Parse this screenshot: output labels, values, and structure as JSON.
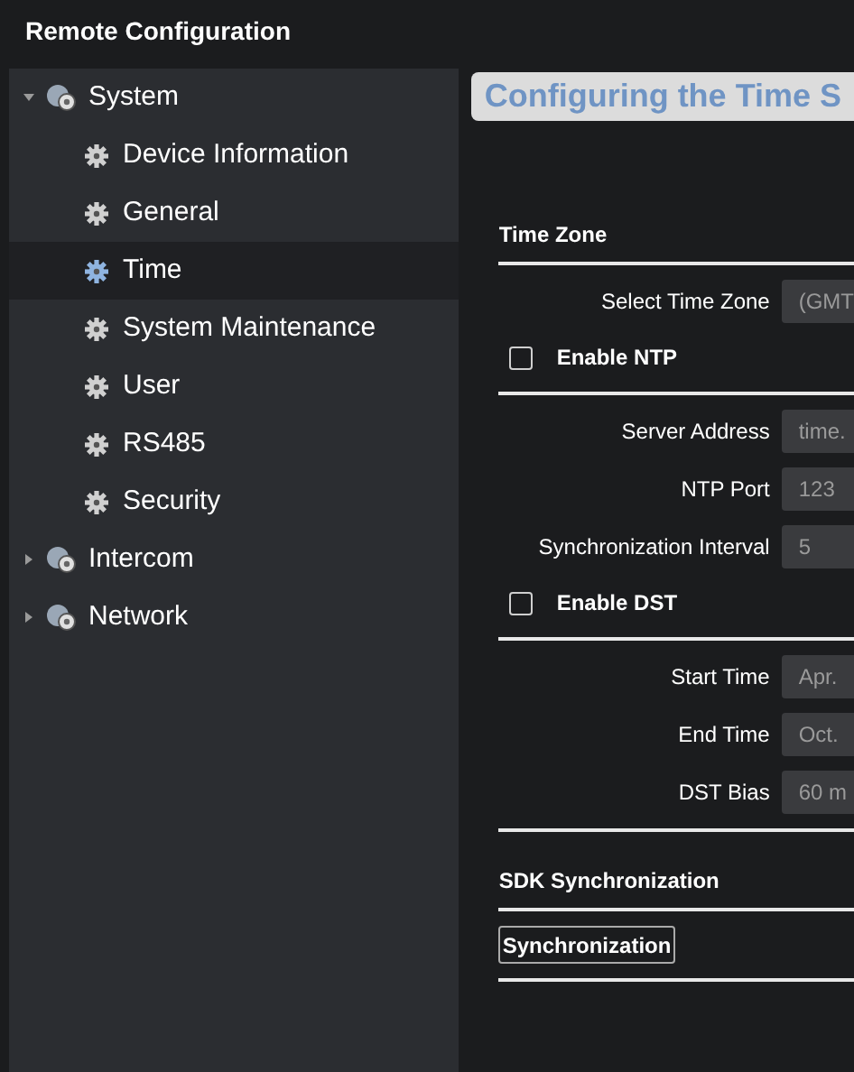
{
  "window": {
    "title": "Remote Configuration"
  },
  "sidebar": {
    "items": [
      {
        "label": "System",
        "expanded": true,
        "selected": false,
        "children": [
          {
            "label": "Device Information",
            "selected": false
          },
          {
            "label": "General",
            "selected": false
          },
          {
            "label": "Time",
            "selected": true
          },
          {
            "label": "System Maintenance",
            "selected": false
          },
          {
            "label": "User",
            "selected": false
          },
          {
            "label": "RS485",
            "selected": false
          },
          {
            "label": "Security",
            "selected": false
          }
        ]
      },
      {
        "label": "Intercom",
        "expanded": false,
        "selected": false
      },
      {
        "label": "Network",
        "expanded": false,
        "selected": false
      }
    ]
  },
  "page_title": "Configuring the Time S",
  "sections": [
    {
      "heading": "Time Zone",
      "rows": [
        {
          "kind": "field",
          "label": "Select Time Zone",
          "value": "(GMT"
        },
        {
          "kind": "checkbox",
          "label": "Enable NTP",
          "checked": false
        }
      ]
    },
    {
      "rows": [
        {
          "kind": "field",
          "label": "Server Address",
          "value": "time."
        },
        {
          "kind": "field",
          "label": "NTP Port",
          "value": "123"
        },
        {
          "kind": "field",
          "label": "Synchronization Interval",
          "value": "5"
        },
        {
          "kind": "checkbox",
          "label": "Enable DST",
          "checked": false
        }
      ]
    },
    {
      "rows": [
        {
          "kind": "field",
          "label": "Start Time",
          "value": "Apr."
        },
        {
          "kind": "field",
          "label": "End Time",
          "value": "Oct."
        },
        {
          "kind": "field",
          "label": "DST Bias",
          "value": "60 m"
        }
      ]
    },
    {
      "heading": "SDK Synchronization",
      "rows": [
        {
          "kind": "button",
          "label": "Synchronization"
        }
      ]
    }
  ]
}
